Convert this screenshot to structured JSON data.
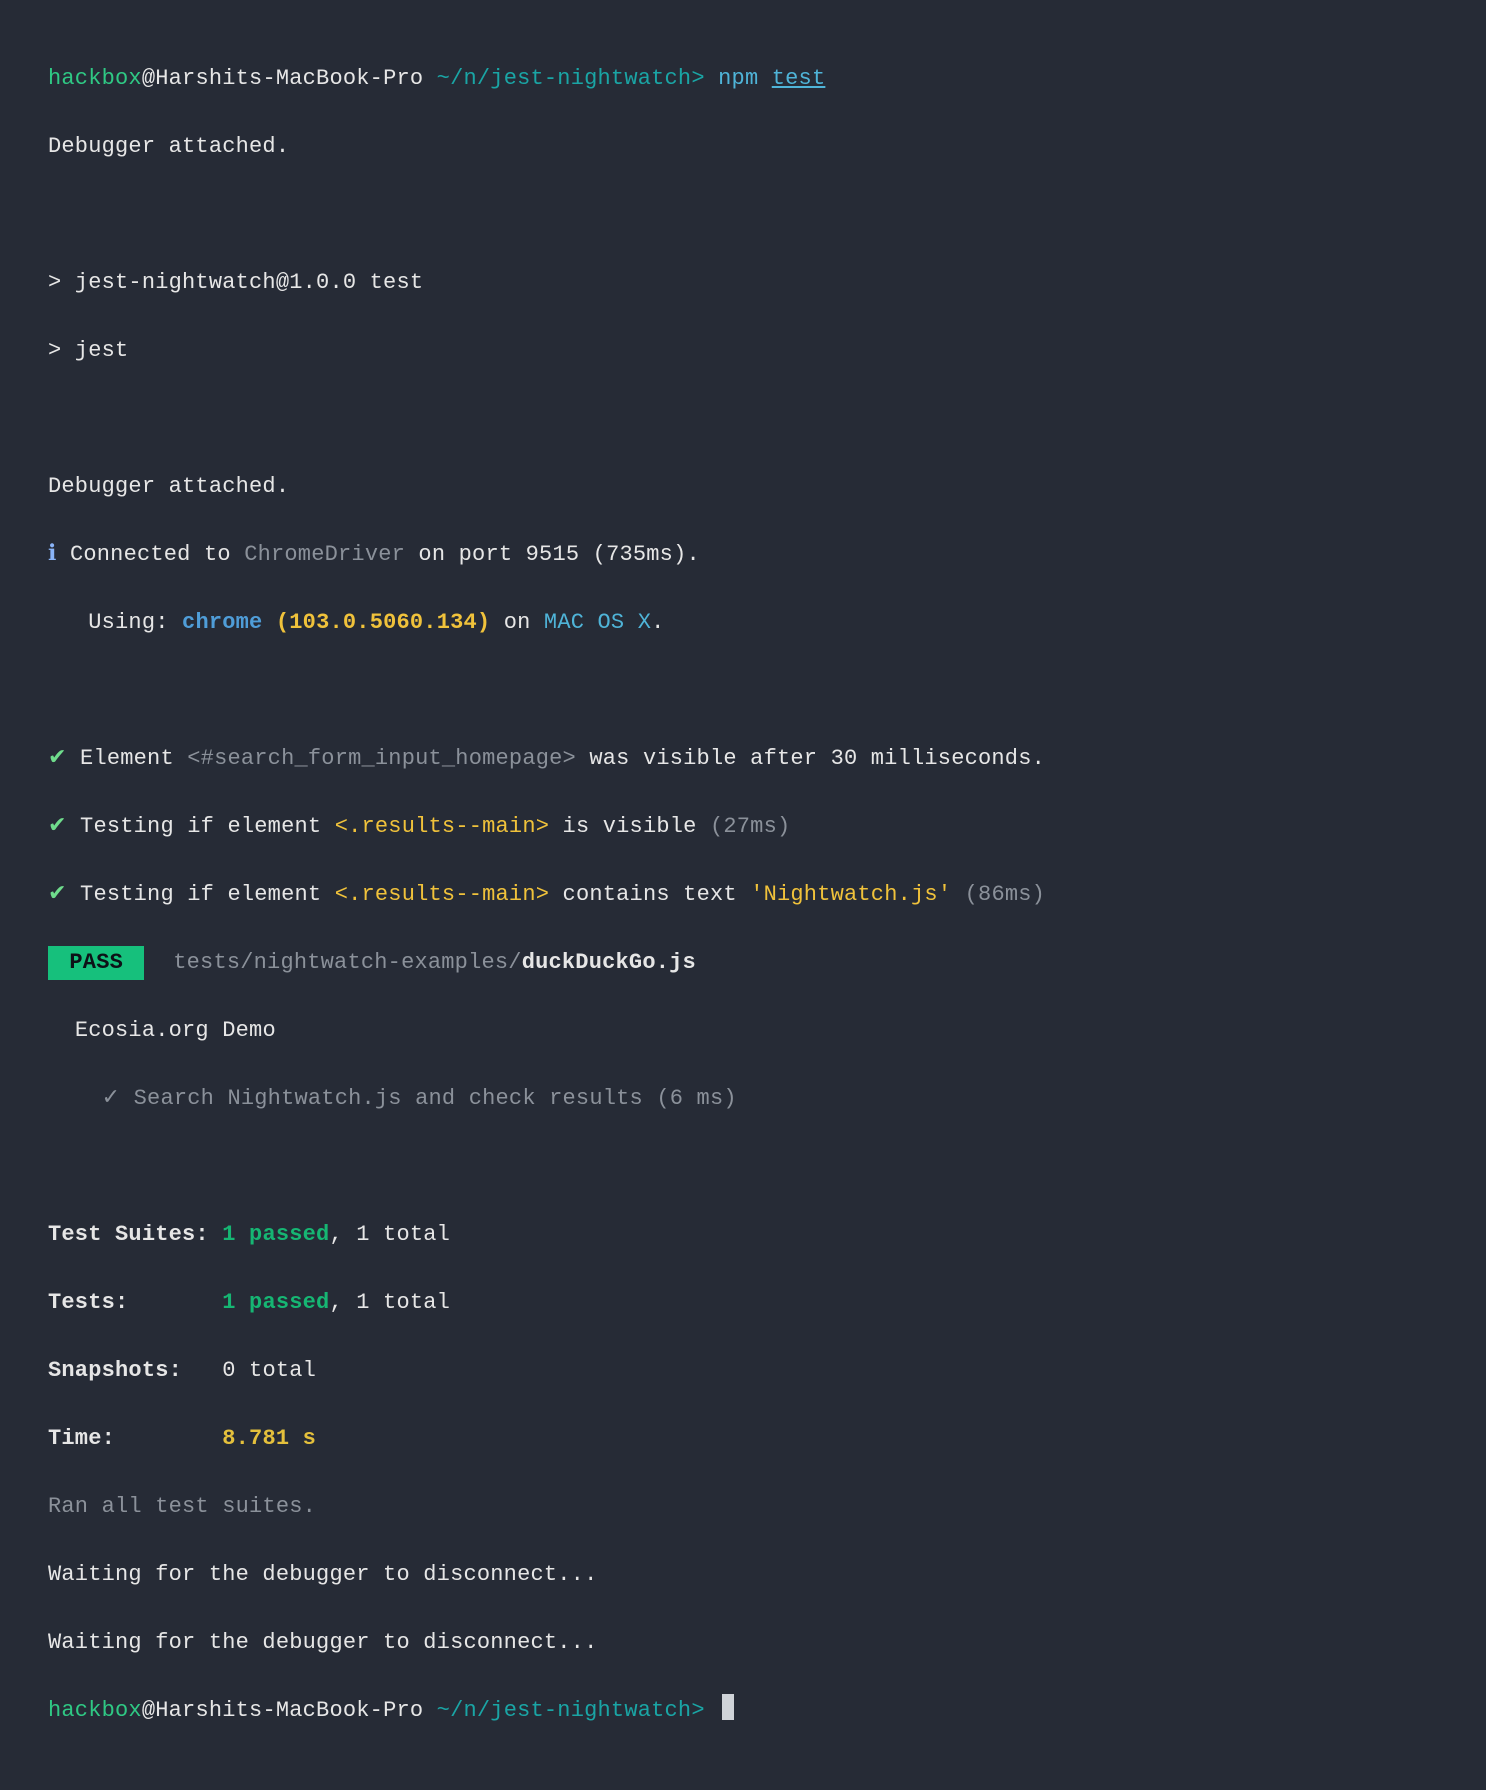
{
  "prompt1": {
    "user": "hackbox",
    "at": "@",
    "host": "Harshits-MacBook-Pro",
    "path": " ~/n/jest-nightwatch",
    "sep": "> ",
    "cmd_a": "npm ",
    "cmd_b": "test"
  },
  "l2": "Debugger attached.",
  "l4": "> jest-nightwatch@1.0.0 test",
  "l5": "> jest",
  "l7": "Debugger attached.",
  "conn": {
    "icon": "ℹ ",
    "a": "Connected to ",
    "driver": "ChromeDriver",
    "b": " on port 9515 (735ms)."
  },
  "using": {
    "indent": "   ",
    "label": "Using: ",
    "browser": "chrome",
    "sp": " ",
    "ver": "(103.0.5060.134)",
    "on": " on ",
    "os": "MAC OS X",
    "dot": "."
  },
  "a1": {
    "tick": "✔ ",
    "p1": "Element ",
    "sel": "<#search_form_input_homepage>",
    "p2": " was visible after 30 milliseconds."
  },
  "a2": {
    "tick": "✔ ",
    "p1": "Testing if element ",
    "sel": "<.results--main>",
    "p2": " is visible ",
    "t": "(27ms)"
  },
  "a3": {
    "tick": "✔ ",
    "p1": "Testing if element ",
    "sel": "<.results--main>",
    "p2": " contains text ",
    "q": "'Nightwatch.js'",
    "sp": " ",
    "t": "(86ms)"
  },
  "pass": {
    "badge": " PASS ",
    "sp": "  ",
    "dir": "tests/nightwatch-examples/",
    "file": "duckDuckGo.js"
  },
  "desc": {
    "indent": "  ",
    "name": "Ecosia.org Demo"
  },
  "test": {
    "indent": "    ",
    "tick": "✓ ",
    "name": "Search Nightwatch.js and check results (6 ms)"
  },
  "sum": {
    "suites_l": "Test Suites: ",
    "suites_p": "1 passed",
    "suites_r": ", 1 total",
    "tests_l": "Tests:       ",
    "tests_p": "1 passed",
    "tests_r": ", 1 total",
    "snap_l": "Snapshots:   ",
    "snap_r": "0 total",
    "time_l": "Time:        ",
    "time_v": "8.781 s"
  },
  "ran": "Ran all test suites.",
  "wait": "Waiting for the debugger to disconnect...",
  "prompt2": {
    "user": "hackbox",
    "at": "@",
    "host": "Harshits-MacBook-Pro",
    "path": " ~/n/jest-nightwatch",
    "sep": "> "
  }
}
